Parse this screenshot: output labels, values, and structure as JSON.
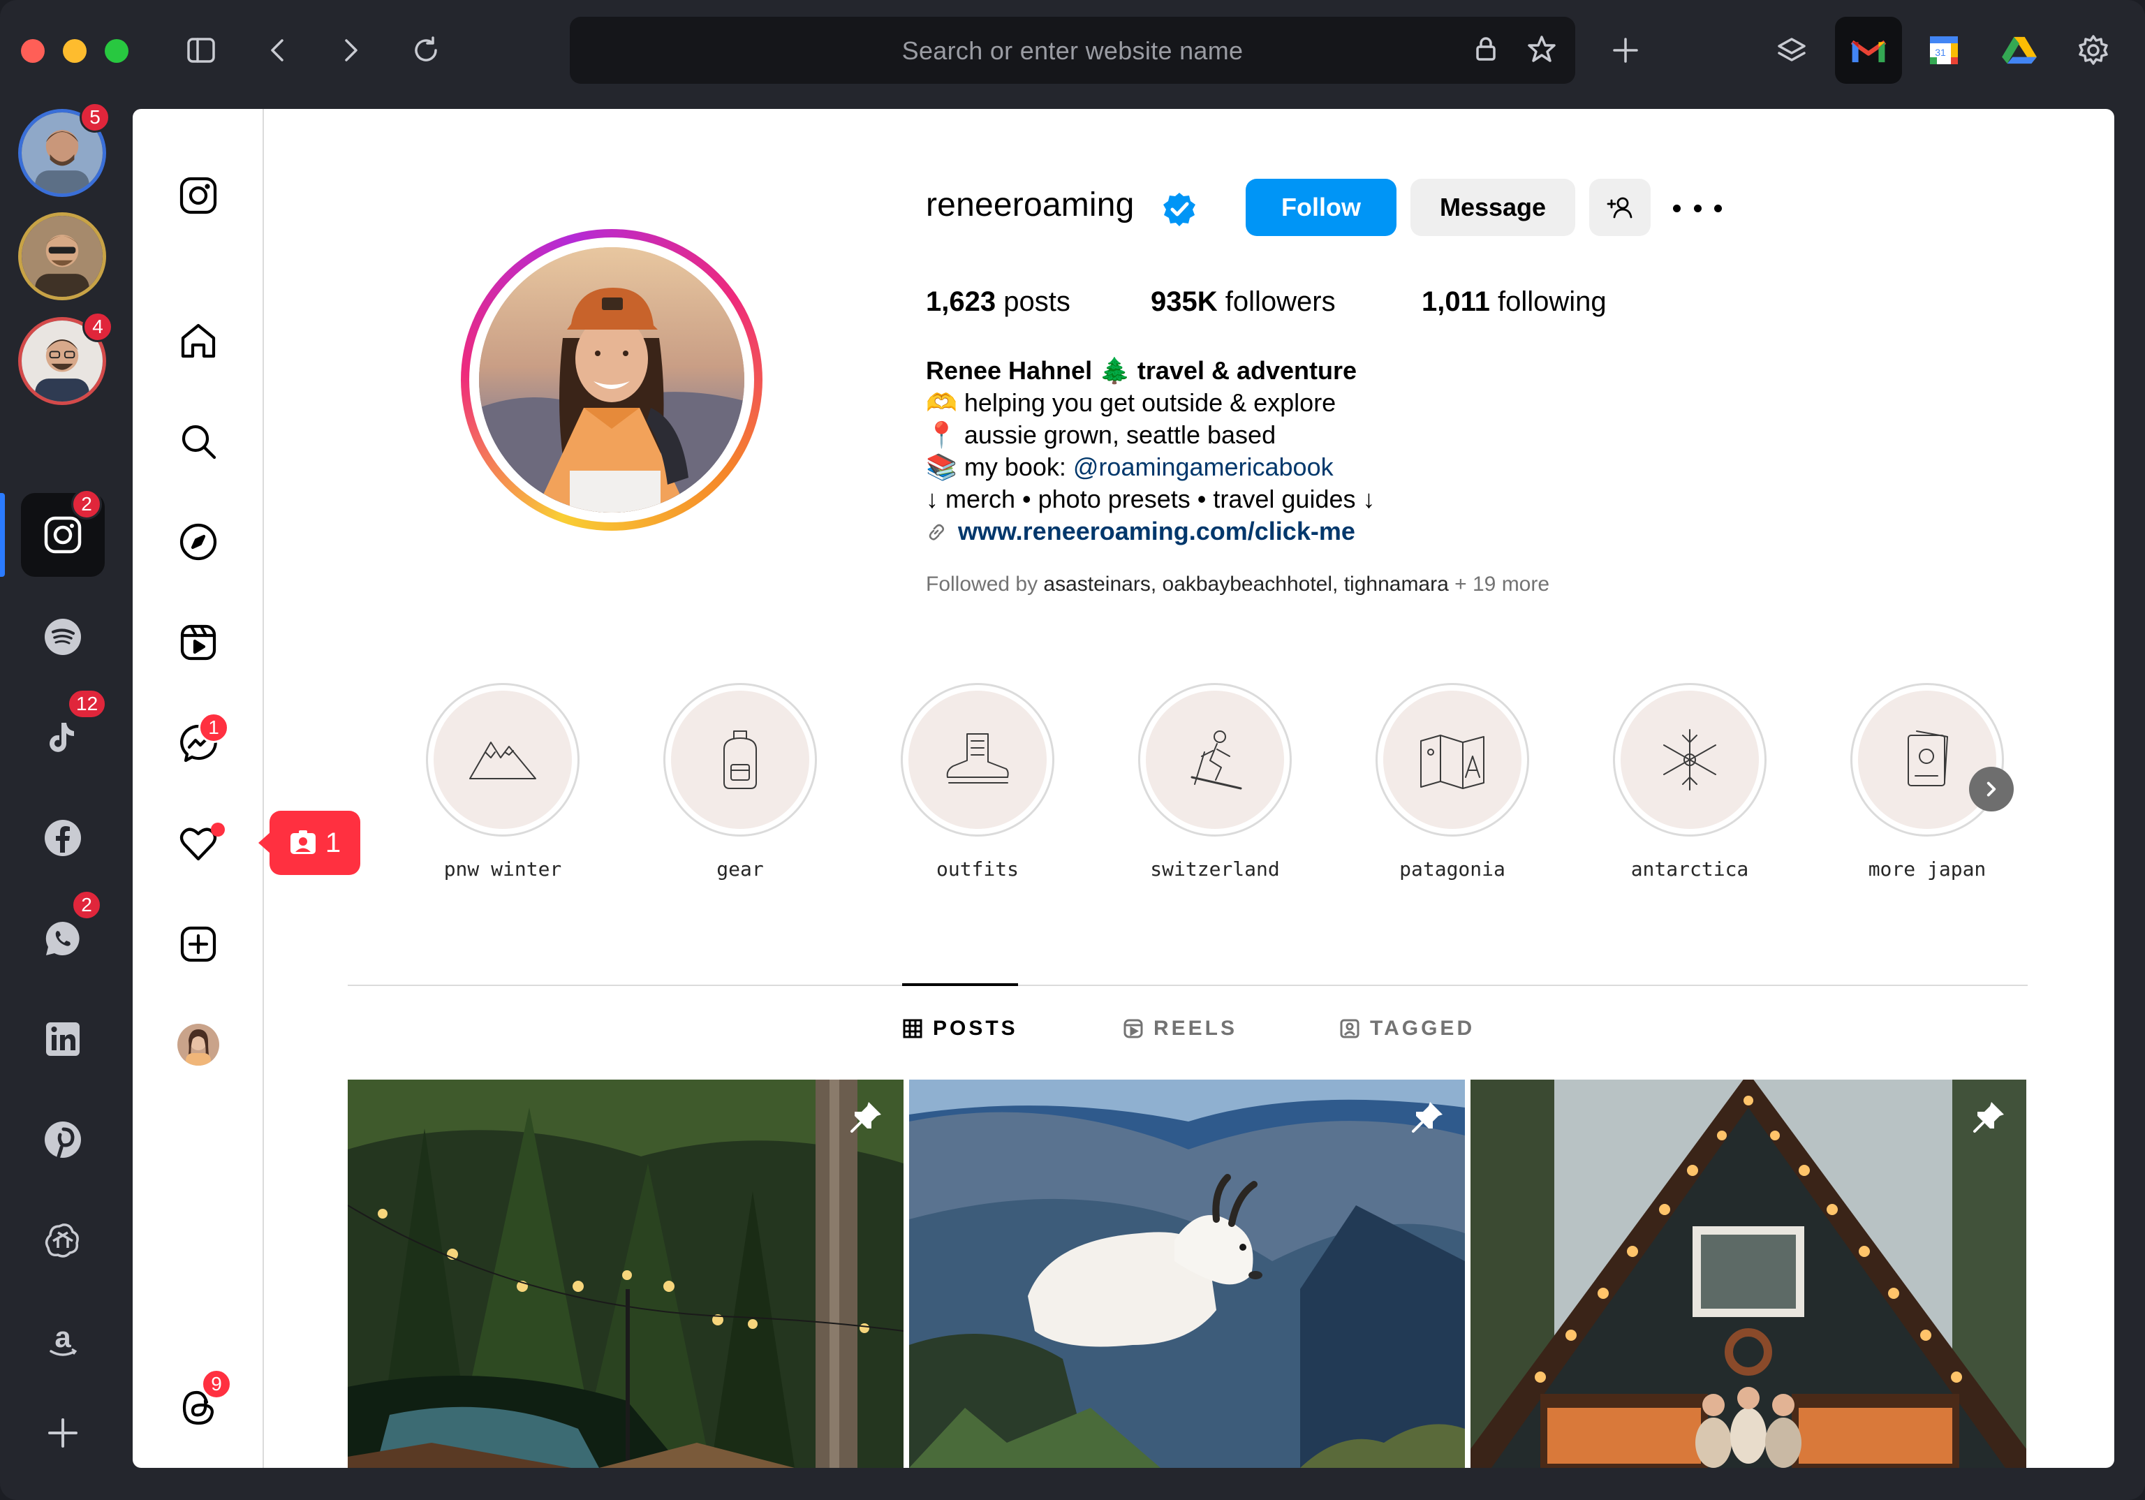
{
  "browser": {
    "address_placeholder": "Search or enter website name",
    "dock_badges": {
      "user1": "5",
      "user3": "4",
      "instagram": "2",
      "tiktok": "12",
      "whatsapp": "2"
    }
  },
  "nav": {
    "messages_badge": "1",
    "threads_badge": "9",
    "notification_popup_count": "1"
  },
  "profile": {
    "username": "reneeroaming",
    "follow_label": "Follow",
    "message_label": "Message",
    "stats": {
      "posts_value": "1,623",
      "posts_label": "posts",
      "followers_value": "935K",
      "followers_label": "followers",
      "following_value": "1,011",
      "following_label": "following"
    },
    "bio": {
      "name_line": "Renee Hahnel 🌲 travel & adventure",
      "line1": "🫶 helping you get outside & explore",
      "line2": "📍 aussie grown, seattle based",
      "line3_prefix": "📚 my book: ",
      "line3_link": "@roamingamericabook",
      "line4": "↓ merch • photo presets • travel guides ↓",
      "url": "www.reneeroaming.com/click-me"
    },
    "followed_by": {
      "prefix": "Followed by ",
      "names": "asasteinars, oakbaybeachhotel, tighnamara",
      "suffix": " + 19 more"
    }
  },
  "highlights": [
    {
      "label": "pnw winter",
      "icon": "mountain-icon"
    },
    {
      "label": "gear",
      "icon": "backpack-icon"
    },
    {
      "label": "outfits",
      "icon": "boot-icon"
    },
    {
      "label": "switzerland",
      "icon": "skier-icon"
    },
    {
      "label": "patagonia",
      "icon": "map-icon"
    },
    {
      "label": "antarctica",
      "icon": "snowflake-icon"
    },
    {
      "label": "more japan",
      "icon": "passport-icon"
    }
  ],
  "tabs": {
    "posts": "POSTS",
    "reels": "REELS",
    "tagged": "TAGGED"
  },
  "colors": {
    "accent": "#0095f6",
    "badge": "#ff3040",
    "dock_bg": "#24262d"
  }
}
